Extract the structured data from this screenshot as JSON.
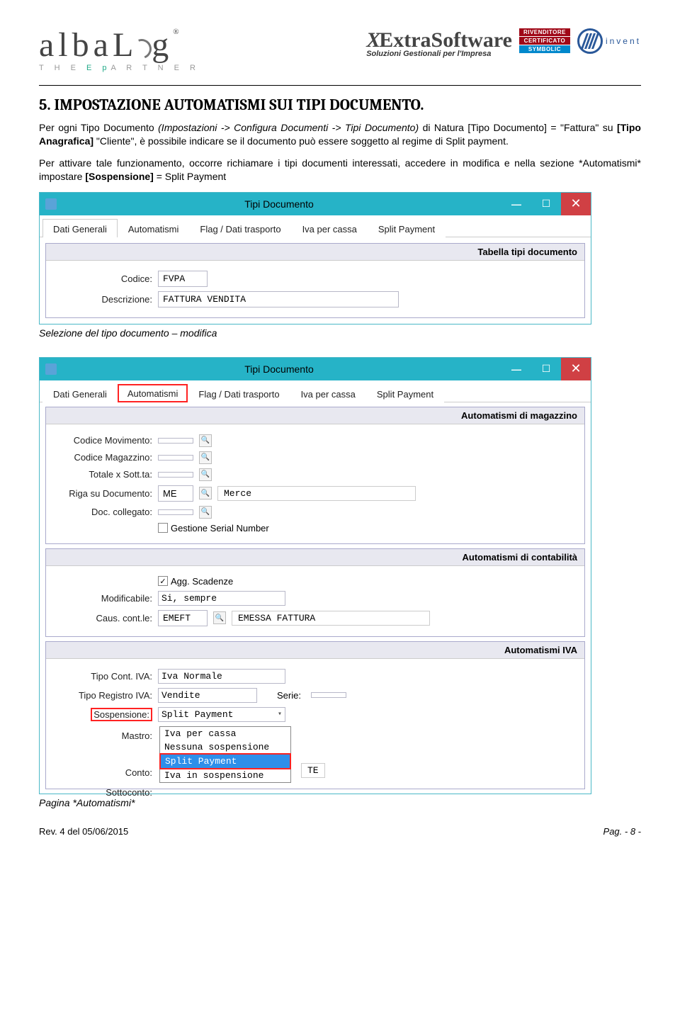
{
  "header": {
    "logo_main": "albaL",
    "logo_suffix": "g",
    "logo_reg": "®",
    "tagline_pre": "T H E  ",
    "tagline_ep": "E p",
    "tagline_post": "A R T N E R",
    "extrasoft": "ExtraSoftware",
    "extrasoft_x": "X",
    "extrasoft_sub": "Soluzioni Gestionali per l'Impresa",
    "badge1": "RIVENDITORE",
    "badge2": "CERTIFICATO",
    "badge3": "SYMBOLIC",
    "hp_text": "invent"
  },
  "section_title": "5. IMPOSTAZIONE AUTOMATISMI SUI TIPI DOCUMENTO.",
  "para1_a": "Per ogni Tipo Documento ",
  "para1_b": "(Impostazioni -> Configura Documenti -> Tipi Documento)",
  "para1_c": " di Natura [Tipo Documento] = \"Fattura\" su ",
  "para1_d": "[Tipo Anagrafica]",
  "para1_e": " \"Cliente\", è possibile indicare se il documento può essere soggetto al regime di Split payment.",
  "para2_a": "Per attivare tale funzionamento, occorre richiamare i tipi documenti interessati, accedere in modifica e nella sezione *Automatismi* impostare ",
  "para2_b": "[Sospensione]",
  "para2_c": " = Split Payment",
  "win1": {
    "title": "Tipi Documento",
    "tabs": [
      "Dati Generali",
      "Automatismi",
      "Flag / Dati trasporto",
      "Iva per cassa",
      "Split Payment"
    ],
    "panel_header": "Tabella tipi documento",
    "codice_label": "Codice:",
    "codice_value": "FVPA",
    "desc_label": "Descrizione:",
    "desc_value": "FATTURA VENDITA"
  },
  "caption1": "Selezione del tipo documento – modifica",
  "win2": {
    "title": "Tipi Documento",
    "tabs": [
      "Dati Generali",
      "Automatismi",
      "Flag / Dati trasporto",
      "Iva per cassa",
      "Split Payment"
    ],
    "grp1_header": "Automatismi di magazzino",
    "f_codmov": "Codice Movimento:",
    "f_codmag": "Codice Magazzino:",
    "f_totsott": "Totale x Sott.ta:",
    "f_riga": "Riga su Documento:",
    "v_riga": "ME",
    "v_riga_desc": "Merce",
    "f_doccoll": "Doc. collegato:",
    "chk_serial": "Gestione Serial Number",
    "grp2_header": "Automatismi di contabilità",
    "chk_agg": "Agg. Scadenze",
    "f_modif": "Modificabile:",
    "v_modif": "Si, sempre",
    "f_caus": "Caus. cont.le:",
    "v_caus": "EMEFT",
    "v_caus_desc": "EMESSA FATTURA",
    "grp3_header": "Automatismi IVA",
    "f_tipocont": "Tipo Cont. IVA:",
    "v_tipocont": "Iva Normale",
    "f_tiporeg": "Tipo Registro IVA:",
    "v_tiporeg": "Vendite",
    "serie_label": "Serie:",
    "f_sosp": "Sospensione:",
    "v_sosp": "Split Payment",
    "f_mastro": "Mastro:",
    "opt1": "Iva per cassa",
    "opt2": "Nessuna sospensione",
    "opt3": "Split Payment",
    "f_conto": "Conto:",
    "side_display": "TE",
    "opt4": "Iva in sospensione",
    "f_sottoc": "Sottoconto:"
  },
  "caption2": "Pagina *Automatismi*",
  "footer": {
    "rev": "Rev. 4 del 05/06/2015",
    "pag": "Pag. - 8 -"
  }
}
